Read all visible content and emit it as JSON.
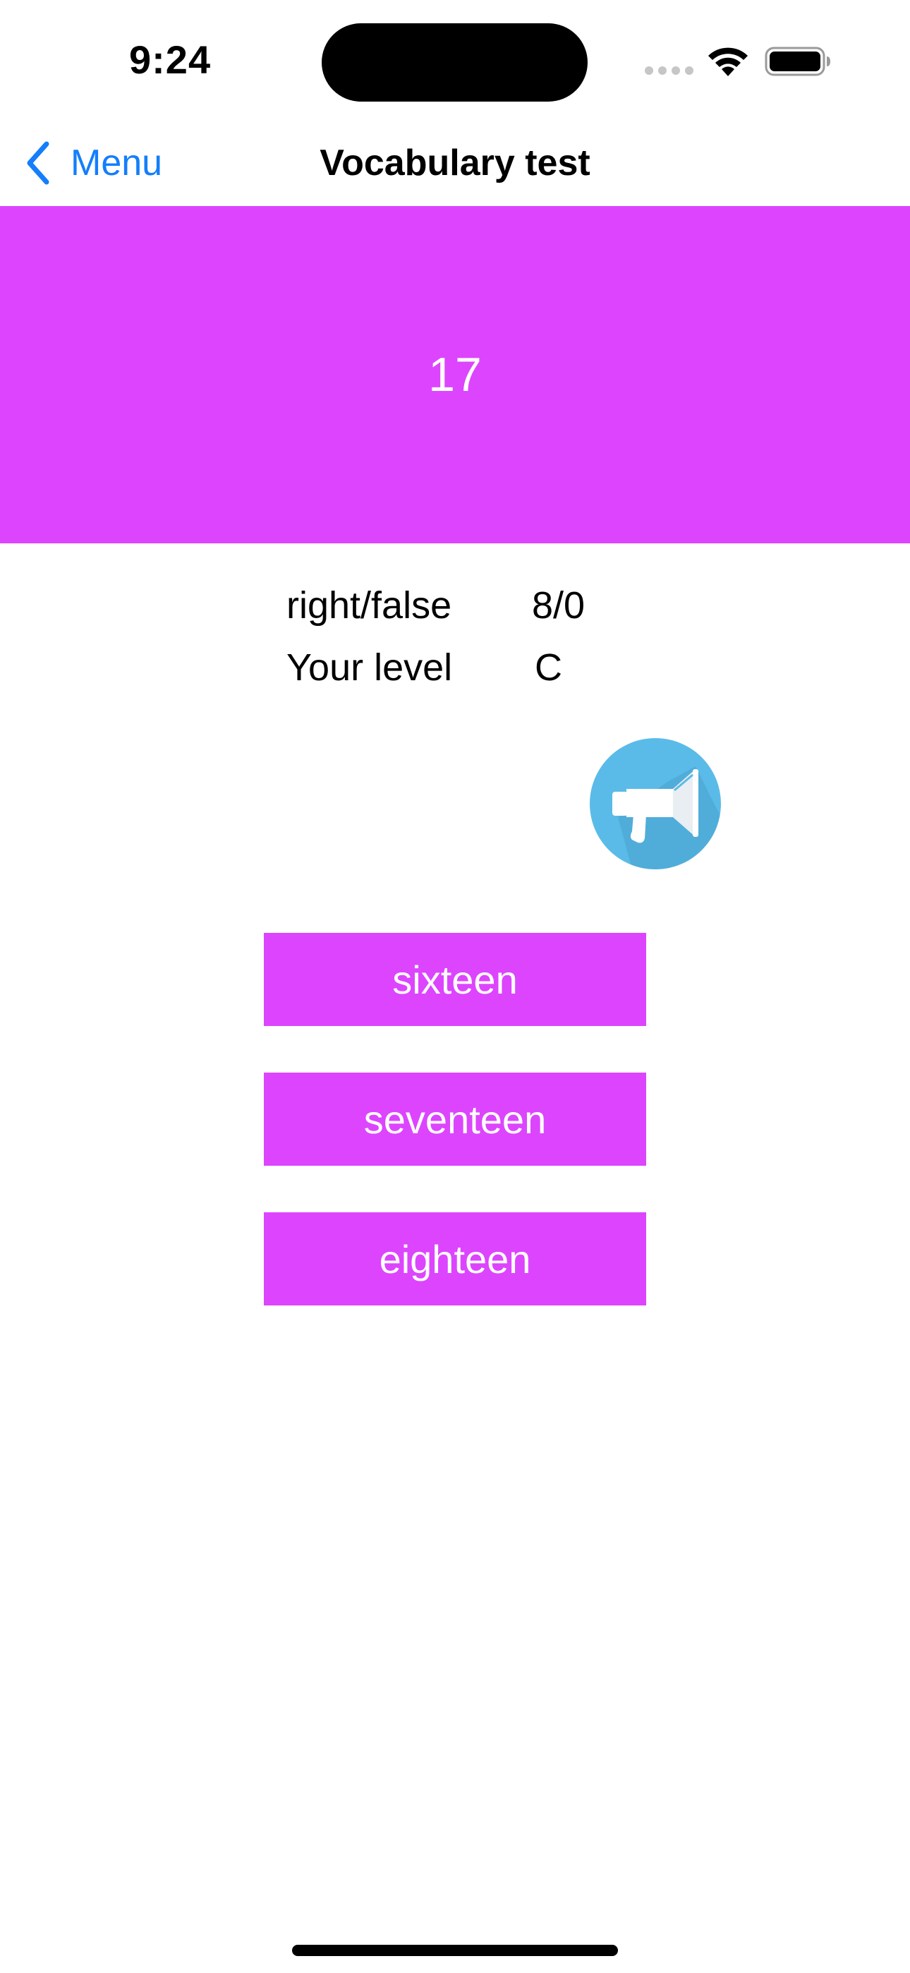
{
  "status_bar": {
    "time": "9:24",
    "icons": [
      "cellular-signal-icon",
      "wifi-icon",
      "battery-icon"
    ]
  },
  "nav": {
    "back_label": "Menu",
    "title": "Vocabulary test"
  },
  "prompt": {
    "word": "17",
    "background_color": "#dc45fd"
  },
  "stats": {
    "score_label": "right/false",
    "score_value": "8/0",
    "level_label": "Your level",
    "level_value": "C"
  },
  "speaker": {
    "icon": "megaphone-icon",
    "color": "#5bbbe8"
  },
  "answers": [
    {
      "label": "sixteen"
    },
    {
      "label": "seventeen"
    },
    {
      "label": "eighteen"
    }
  ],
  "colors": {
    "accent": "#147efb",
    "button": "#dc45fd"
  }
}
